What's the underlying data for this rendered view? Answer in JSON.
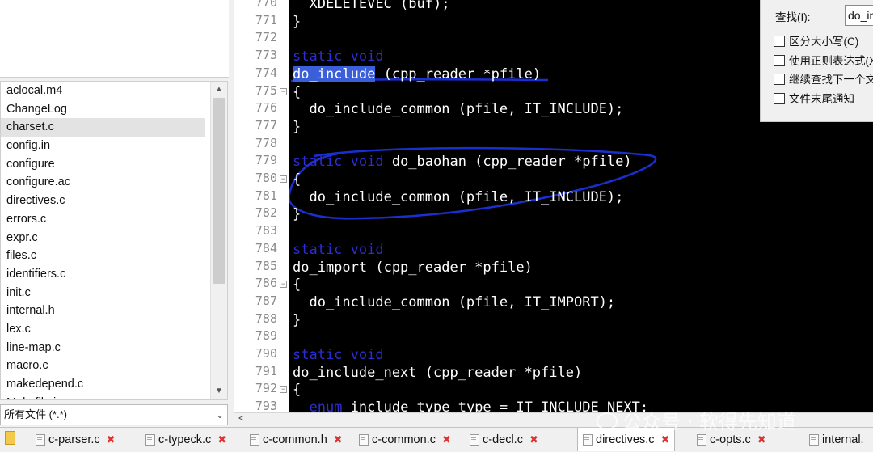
{
  "file_list": {
    "items": [
      "aclocal.m4",
      "ChangeLog",
      "charset.c",
      "config.in",
      "configure",
      "configure.ac",
      "directives.c",
      "errors.c",
      "expr.c",
      "files.c",
      "identifiers.c",
      "init.c",
      "internal.h",
      "lex.c",
      "line-map.c",
      "macro.c",
      "makedepend.c",
      "Makefile.in"
    ],
    "selected": "charset.c"
  },
  "filter": {
    "value": "所有文件 (*.*)"
  },
  "editor": {
    "lines": [
      {
        "n": "770",
        "segs": [
          {
            "t": "  XDELETEVEC (buf);",
            "c": "n"
          }
        ]
      },
      {
        "n": "771",
        "segs": [
          {
            "t": "}",
            "c": "n"
          }
        ]
      },
      {
        "n": "772",
        "segs": []
      },
      {
        "n": "773",
        "segs": [
          {
            "t": "static void",
            "c": "kw"
          }
        ]
      },
      {
        "n": "774",
        "segs": [
          {
            "t": "do_include",
            "c": "hl"
          },
          {
            "t": " (cpp_reader *pfile)",
            "c": "n"
          }
        ]
      },
      {
        "n": "775",
        "fold": true,
        "segs": [
          {
            "t": "{",
            "c": "n"
          }
        ]
      },
      {
        "n": "776",
        "segs": [
          {
            "t": "  do_include_common (pfile, IT_INCLUDE);",
            "c": "n"
          }
        ]
      },
      {
        "n": "777",
        "segs": [
          {
            "t": "}",
            "c": "n"
          }
        ]
      },
      {
        "n": "778",
        "segs": []
      },
      {
        "n": "779",
        "segs": [
          {
            "t": "static void",
            "c": "kw"
          },
          {
            "t": " do_baohan (cpp_reader *pfile)",
            "c": "n"
          }
        ]
      },
      {
        "n": "780",
        "fold": true,
        "segs": [
          {
            "t": "{",
            "c": "n"
          }
        ]
      },
      {
        "n": "781",
        "segs": [
          {
            "t": "  do_include_common (pfile, IT_INCLUDE);",
            "c": "n"
          }
        ]
      },
      {
        "n": "782",
        "segs": [
          {
            "t": "}",
            "c": "n"
          }
        ]
      },
      {
        "n": "783",
        "segs": []
      },
      {
        "n": "784",
        "segs": [
          {
            "t": "static void",
            "c": "kw"
          }
        ]
      },
      {
        "n": "785",
        "segs": [
          {
            "t": "do_import (cpp_reader *pfile)",
            "c": "n"
          }
        ]
      },
      {
        "n": "786",
        "fold": true,
        "segs": [
          {
            "t": "{",
            "c": "n"
          }
        ]
      },
      {
        "n": "787",
        "segs": [
          {
            "t": "  do_include_common (pfile, IT_IMPORT);",
            "c": "n"
          }
        ]
      },
      {
        "n": "788",
        "segs": [
          {
            "t": "}",
            "c": "n"
          }
        ]
      },
      {
        "n": "789",
        "segs": []
      },
      {
        "n": "790",
        "segs": [
          {
            "t": "static void",
            "c": "kw"
          }
        ]
      },
      {
        "n": "791",
        "segs": [
          {
            "t": "do_include_next (cpp_reader *pfile)",
            "c": "n"
          }
        ]
      },
      {
        "n": "792",
        "fold": true,
        "segs": [
          {
            "t": "{",
            "c": "n"
          }
        ]
      },
      {
        "n": "793",
        "segs": [
          {
            "t": "  ",
            "c": "n"
          },
          {
            "t": "enum",
            "c": "kw"
          },
          {
            "t": " include_type type = IT_INCLUDE_NEXT;",
            "c": "n"
          }
        ]
      }
    ]
  },
  "find_panel": {
    "label": "查找(I):",
    "value": "do_include",
    "options": [
      "区分大小写(C)",
      "使用正则表达式(X)",
      "继续查找下一个文件",
      "文件末尾通知"
    ]
  },
  "tabs": [
    {
      "label": "c-parser.c",
      "active": false
    },
    {
      "label": "c-typeck.c",
      "active": false
    },
    {
      "label": "c-common.h",
      "active": false
    },
    {
      "label": "c-common.c",
      "active": false
    },
    {
      "label": "c-decl.c",
      "active": false
    },
    {
      "label": "directives.c",
      "active": true
    },
    {
      "label": "c-opts.c",
      "active": false
    },
    {
      "label": "internal.",
      "active": false
    }
  ],
  "watermark": "公众号 · 软得先知道",
  "icons": {
    "tab_close": "close-icon",
    "tab_file": "file-icon",
    "fold": "fold-minus-icon"
  },
  "colors": {
    "editor_bg": "#000000",
    "keyword": "#2d2dd6",
    "selection": "#3a5fd9",
    "annotation": "#1a2fd0",
    "close": "#dd3333"
  }
}
